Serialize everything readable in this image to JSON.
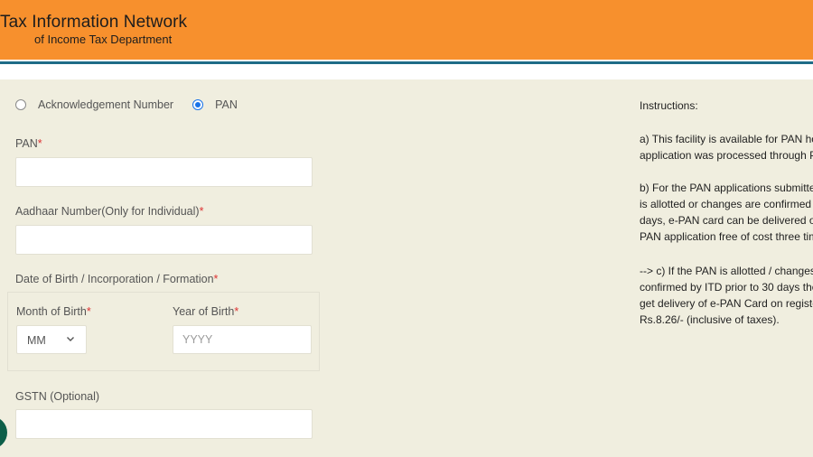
{
  "header": {
    "title": "Tax Information Network",
    "subtitle": "of Income Tax Department"
  },
  "radio": {
    "ack_label": "Acknowledgement Number",
    "pan_label": "PAN",
    "selected": "PAN"
  },
  "form": {
    "pan_label": "PAN",
    "aadhaar_label": "Aadhaar Number(Only for Individual)",
    "dob_label": "Date of Birth / Incorporation / Formation",
    "month_label": "Month of Birth",
    "month_value": "MM",
    "year_label": "Year of Birth",
    "year_placeholder": "YYYY",
    "gstn_label": "GSTN (Optional)",
    "required_mark": "*"
  },
  "instructions": {
    "heading": "Instructions:",
    "a": [
      "a) This facility is available for PAN ho",
      "application was processed through P"
    ],
    "b": [
      "b) For the PAN applications submitte",
      "is allotted or changes are confirmed b",
      "days, e-PAN card can be delivered o",
      "PAN application free of cost three tim"
    ],
    "c": [
      "--> c) If the PAN is allotted / changes",
      "confirmed by ITD prior to 30 days the",
      "get delivery of e-PAN Card on registe",
      "Rs.8.26/- (inclusive of taxes)."
    ]
  },
  "colors": {
    "header_bg": "#f7902d",
    "stripe_blue": "#1f6c87",
    "page_bg": "#f0eedf",
    "radio_selected": "#1a73e8",
    "required": "#dd3333"
  }
}
